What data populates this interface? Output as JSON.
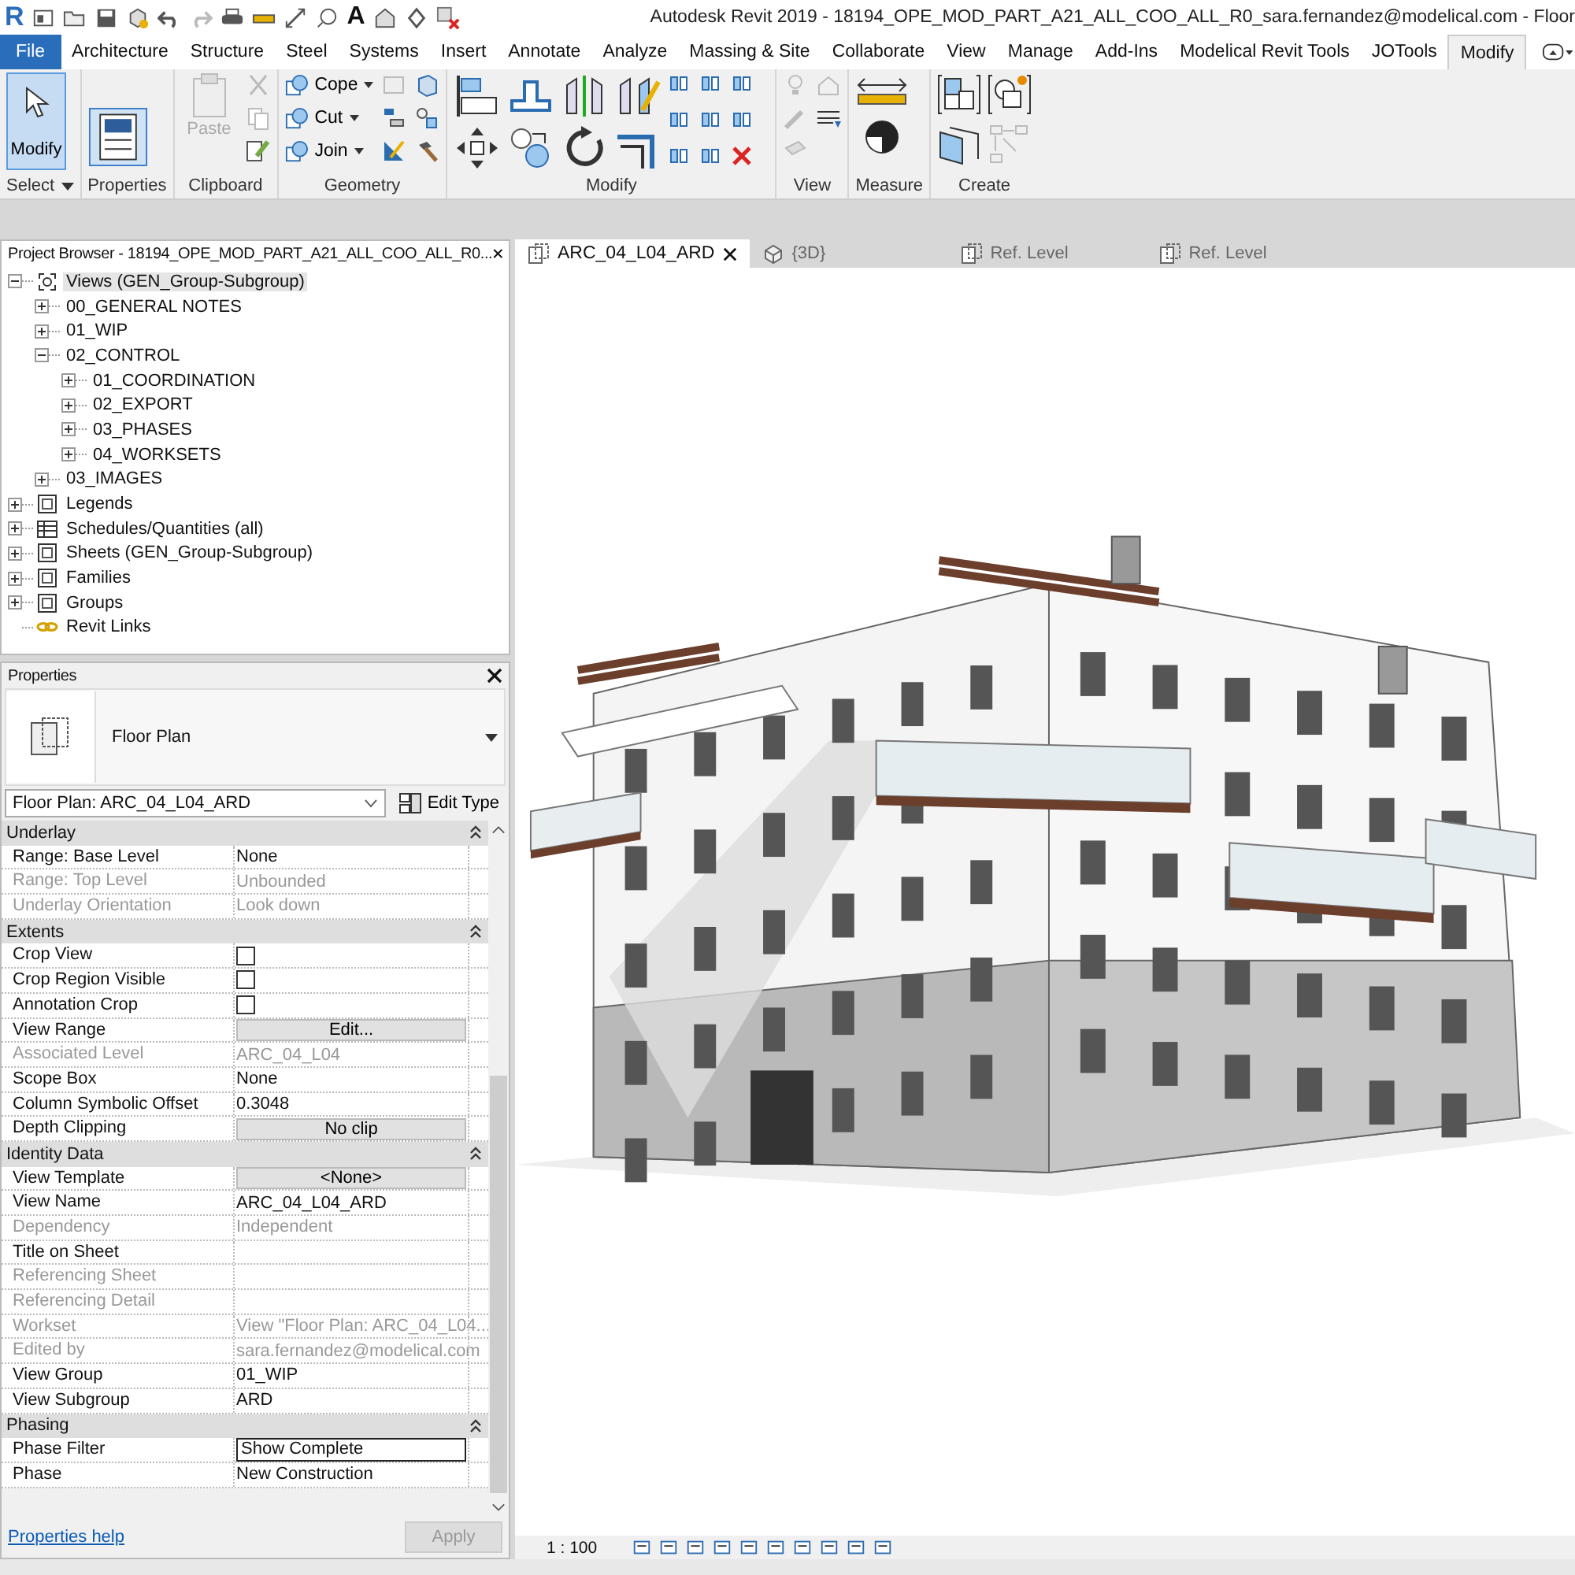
{
  "title_bar": {
    "logo": "R",
    "text_glyph": "A",
    "title": "Autodesk Revit 2019 - 18194_OPE_MOD_PART_A21_ALL_COO_ALL_R0_sara.fernandez@modelical.com - Floor"
  },
  "ribbon_tabs": [
    {
      "label": "File",
      "kind": "file",
      "selected": false
    },
    {
      "label": "Architecture",
      "kind": "tab",
      "selected": false
    },
    {
      "label": "Structure",
      "kind": "tab",
      "selected": false
    },
    {
      "label": "Steel",
      "kind": "tab",
      "selected": false
    },
    {
      "label": "Systems",
      "kind": "tab",
      "selected": false
    },
    {
      "label": "Insert",
      "kind": "tab",
      "selected": false
    },
    {
      "label": "Annotate",
      "kind": "tab",
      "selected": false
    },
    {
      "label": "Analyze",
      "kind": "tab",
      "selected": false
    },
    {
      "label": "Massing & Site",
      "kind": "tab",
      "selected": false
    },
    {
      "label": "Collaborate",
      "kind": "tab",
      "selected": false
    },
    {
      "label": "View",
      "kind": "tab",
      "selected": false
    },
    {
      "label": "Manage",
      "kind": "tab",
      "selected": false
    },
    {
      "label": "Add-Ins",
      "kind": "tab",
      "selected": false
    },
    {
      "label": "Modelical Revit Tools",
      "kind": "tab",
      "selected": false
    },
    {
      "label": "JOTools",
      "kind": "tab",
      "selected": false
    },
    {
      "label": "Modify",
      "kind": "tab",
      "selected": true
    }
  ],
  "ribbon_panels": [
    {
      "kind": "select",
      "title": "Select",
      "tools": [
        {
          "label": "Modify",
          "selected": true
        }
      ]
    },
    {
      "kind": "properties",
      "title": "Properties"
    },
    {
      "kind": "clipboard",
      "title": "Clipboard",
      "tools": [
        {
          "label": "Paste",
          "disabled": true
        }
      ]
    },
    {
      "kind": "geometry",
      "title": "Geometry",
      "tools": [
        {
          "label": "Cope"
        },
        {
          "label": "Cut"
        },
        {
          "label": "Join"
        }
      ]
    },
    {
      "kind": "modify",
      "title": "Modify"
    },
    {
      "kind": "view",
      "title": "View"
    },
    {
      "kind": "measure",
      "title": "Measure"
    },
    {
      "kind": "create",
      "title": "Create"
    }
  ],
  "project_browser": {
    "title": "Project Browser - 18194_OPE_MOD_PART_A21_ALL_COO_ALL_R0...",
    "tree": [
      {
        "label": "Views (GEN_Group-Subgroup)",
        "kind": "views",
        "expanded": true,
        "selected": true,
        "children": [
          {
            "label": "00_GENERAL NOTES",
            "expanded": false,
            "selected": false
          },
          {
            "label": "01_WIP",
            "expanded": false,
            "selected": false
          },
          {
            "label": "02_CONTROL",
            "expanded": true,
            "selected": false,
            "children": [
              {
                "label": "01_COORDINATION",
                "expanded": false,
                "selected": false
              },
              {
                "label": "02_EXPORT",
                "expanded": false,
                "selected": false
              },
              {
                "label": "03_PHASES",
                "expanded": false,
                "selected": false
              },
              {
                "label": "04_WORKSETS",
                "expanded": false,
                "selected": false
              }
            ]
          },
          {
            "label": "03_IMAGES",
            "expanded": false,
            "selected": false
          }
        ]
      },
      {
        "label": "Legends",
        "kind": "legends",
        "expanded": false,
        "selected": false
      },
      {
        "label": "Schedules/Quantities (all)",
        "kind": "schedules",
        "expanded": false,
        "selected": false
      },
      {
        "label": "Sheets (GEN_Group-Subgroup)",
        "kind": "sheets",
        "expanded": false,
        "selected": false
      },
      {
        "label": "Families",
        "kind": "families",
        "expanded": false,
        "selected": false
      },
      {
        "label": "Groups",
        "kind": "groups",
        "expanded": false,
        "selected": false
      },
      {
        "label": "Revit Links",
        "kind": "links",
        "selected": false
      }
    ]
  },
  "properties": {
    "title": "Properties",
    "type_name": "Floor Plan",
    "instance": "Floor Plan: ARC_04_L04_ARD",
    "edit_type": "Edit Type",
    "rows": [
      {
        "kind": "group",
        "label": "Underlay"
      },
      {
        "kind": "text",
        "label": "Range: Base Level",
        "value": "None",
        "disabled": false
      },
      {
        "kind": "text",
        "label": "Range: Top Level",
        "value": "Unbounded",
        "disabled": true
      },
      {
        "kind": "text",
        "label": "Underlay Orientation",
        "value": "Look down",
        "disabled": true
      },
      {
        "kind": "group",
        "label": "Extents"
      },
      {
        "kind": "checkbox",
        "label": "Crop View",
        "checked": false
      },
      {
        "kind": "checkbox",
        "label": "Crop Region Visible",
        "checked": false
      },
      {
        "kind": "checkbox",
        "label": "Annotation Crop",
        "checked": false
      },
      {
        "kind": "button",
        "label": "View Range",
        "value": "Edit..."
      },
      {
        "kind": "text",
        "label": "Associated Level",
        "value": "ARC_04_L04",
        "disabled": true
      },
      {
        "kind": "text",
        "label": "Scope Box",
        "value": "None",
        "disabled": false
      },
      {
        "kind": "text",
        "label": "Column Symbolic Offset",
        "value": "0.3048",
        "disabled": false
      },
      {
        "kind": "button",
        "label": "Depth Clipping",
        "value": "No clip"
      },
      {
        "kind": "group",
        "label": "Identity Data"
      },
      {
        "kind": "button",
        "label": "View Template",
        "value": "<None>"
      },
      {
        "kind": "text",
        "label": "View Name",
        "value": "ARC_04_L04_ARD",
        "disabled": false
      },
      {
        "kind": "text",
        "label": "Dependency",
        "value": "Independent",
        "disabled": true
      },
      {
        "kind": "text",
        "label": "Title on Sheet",
        "disabled": false
      },
      {
        "kind": "text",
        "label": "Referencing Sheet",
        "disabled": true
      },
      {
        "kind": "text",
        "label": "Referencing Detail",
        "disabled": true
      },
      {
        "kind": "text",
        "label": "Workset",
        "value": "View \"Floor Plan: ARC_04_L04...",
        "disabled": true
      },
      {
        "kind": "text",
        "label": "Edited by",
        "value": "sara.fernandez@modelical.com",
        "disabled": true
      },
      {
        "kind": "text",
        "label": "View Group",
        "value": "01_WIP",
        "disabled": false
      },
      {
        "kind": "text",
        "label": "View Subgroup",
        "value": "ARD",
        "disabled": false
      },
      {
        "kind": "group",
        "label": "Phasing"
      },
      {
        "kind": "input",
        "label": "Phase Filter",
        "value": "Show Complete"
      },
      {
        "kind": "text",
        "label": "Phase",
        "value": "New Construction",
        "disabled": false
      }
    ],
    "help_link": "Properties help",
    "apply": {
      "label": "Apply",
      "disabled": true
    }
  },
  "view_tabs": [
    {
      "label": "ARC_04_L04_ARD",
      "kind": "plan",
      "selected": true
    },
    {
      "label": "{3D}",
      "kind": "model",
      "selected": false
    },
    {
      "label": "Ref. Level",
      "kind": "plan",
      "selected": false
    },
    {
      "label": "Ref. Level",
      "kind": "plan",
      "selected": false
    }
  ],
  "view_control_bar": {
    "scale": "1 : 100"
  }
}
